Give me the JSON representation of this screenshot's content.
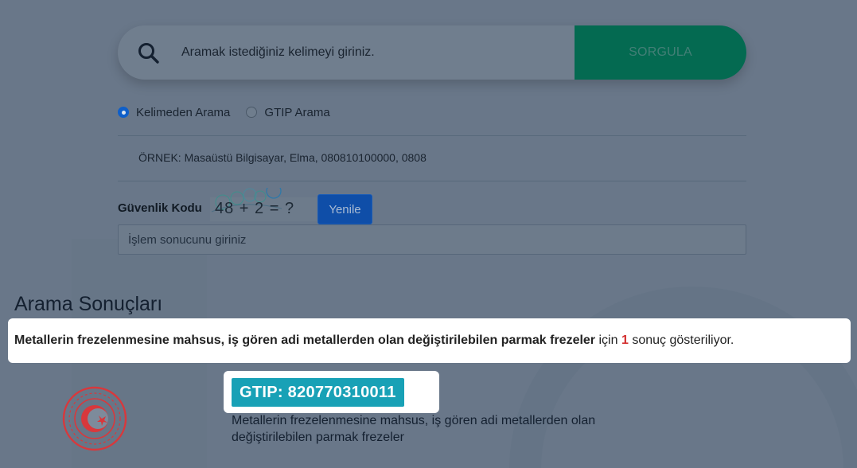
{
  "search": {
    "placeholder": "Aramak istediğiniz kelimeyi giriniz.",
    "button_label": "SORGULA"
  },
  "search_mode": {
    "options": [
      {
        "label": "Kelimeden Arama",
        "selected": true
      },
      {
        "label": "GTIP Arama",
        "selected": false
      }
    ]
  },
  "example": "ÖRNEK: Masaüstü Bilgisayar, Elma, 080810100000, 0808",
  "security": {
    "label": "Güvenlik Kodu",
    "captcha_text": "48 + 2 = ?",
    "refresh_label": "Yenile",
    "input_placeholder": "İşlem sonucunu giriniz"
  },
  "results": {
    "heading": "Arama Sonuçları",
    "query": "Metallerin frezelenmesine mahsus, iş gören adi metallerden olan değiştirilebilen parmak frezeler",
    "prefix": "için",
    "count": "1",
    "suffix": "sonuç gösteriliyor.",
    "items": [
      {
        "gtip": "GTIP: 820770310011",
        "description": "Metallerin frezelenmesine mahsus, iş gören adi metallerden olan değiştirilebilen parmak frezeler"
      }
    ]
  },
  "colors": {
    "search_button": "#046a51",
    "refresh_button": "#0f4ea8",
    "gtip_badge": "#18a1b6",
    "result_count": "#d32f2f",
    "logo_red": "#d8383c"
  },
  "icons": {
    "search": "search-icon",
    "logo": "ministry-emblem-icon"
  }
}
